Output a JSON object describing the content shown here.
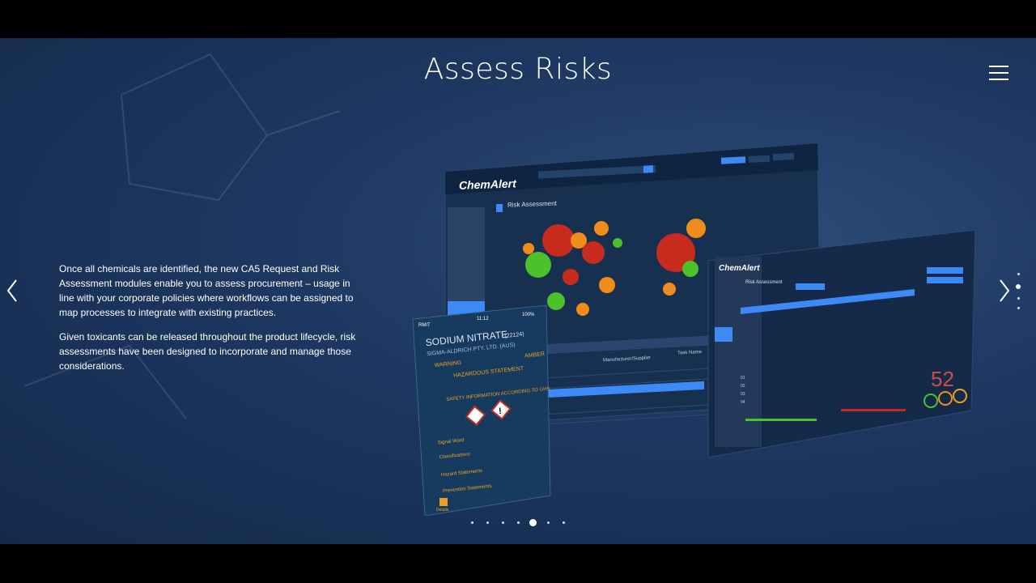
{
  "header": {
    "title": "Assess Risks"
  },
  "content": {
    "paragraphs": [
      "Once all chemicals are identified, the new CA5 Request and Risk Assessment modules enable you to assess procurement – usage in line with your corporate policies where workflows can be assigned to map processes to integrate with existing practices.",
      "Given toxicants can be released throughout the product lifecycle, risk assessments have been designed to incorporate and manage those considerations."
    ]
  },
  "nav": {
    "prev_icon": "chevron-left-icon",
    "next_icon": "chevron-right-icon",
    "menu_icon": "hamburger-menu-icon",
    "pager_count": 7,
    "pager_active": 5,
    "side_dots_count": 4,
    "side_dots_active": 2
  },
  "mockup": {
    "brand": "ChemAlert",
    "desktop_section": "Risk Assessment",
    "tablet_section": "Risk Assessment",
    "phone": {
      "status_left": "RMIT",
      "status_time": "11:12",
      "status_right": "100%",
      "product": "SODIUM NITRATE",
      "product_code": "(22124)",
      "supplier": "SIGMA-ALDRICH PTY. LTD. (AUS)",
      "warning_label": "WARNING",
      "rating": "AMBER",
      "statement_title": "HAZARDOUS STATEMENT",
      "safety_title": "SAFETY INFORMATION ACCORDING TO GHS",
      "signal_word_label": "Signal Word",
      "classifications_label": "Classifications",
      "hazard_statements_label": "Hazard Statements",
      "prevention_label": "Prevention Statements",
      "tab_details": "Details"
    },
    "desktop_columns": [
      "Manufacturer/Supplier",
      "Task Name"
    ],
    "tablet_rows": [
      "01",
      "02",
      "03",
      "04"
    ],
    "tablet_score": "52",
    "colors": {
      "accent_blue": "#3d8af7",
      "bubble_red": "#c62b1e",
      "bubble_green": "#4cc12a",
      "bubble_orange": "#f08c1a",
      "amber": "#f0a020"
    }
  }
}
